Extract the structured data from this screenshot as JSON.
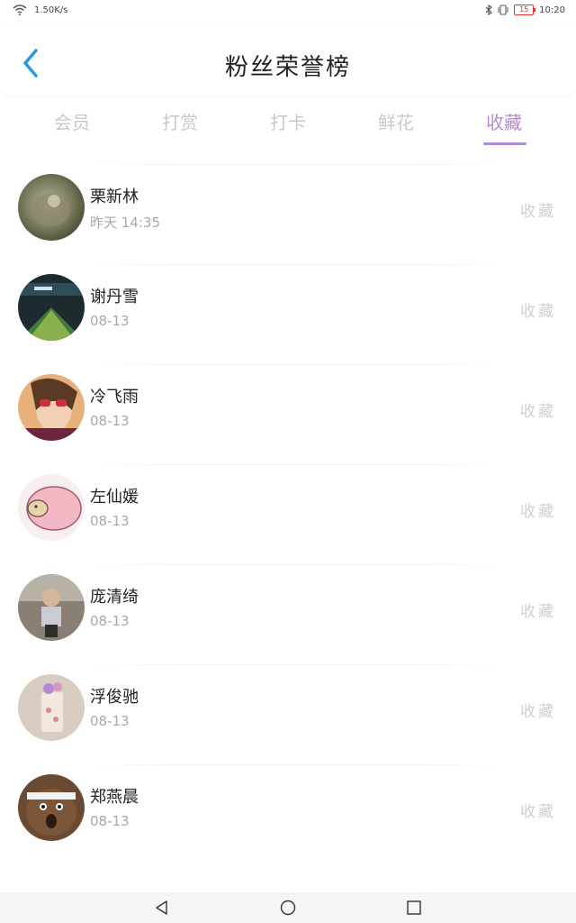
{
  "status_bar": {
    "net_speed": "1.50K/s",
    "battery": "15",
    "time": "10:20"
  },
  "header": {
    "title": "粉丝荣誉榜",
    "back_icon": "chevron-left-icon",
    "accent": "#2a9be0"
  },
  "tabs": [
    {
      "label": "会员",
      "active": false
    },
    {
      "label": "打赏",
      "active": false
    },
    {
      "label": "打卡",
      "active": false
    },
    {
      "label": "鲜花",
      "active": false
    },
    {
      "label": "收藏",
      "active": true
    }
  ],
  "active_color": "#b58bd6",
  "fans": [
    {
      "name": "栗新林",
      "time": "昨天 14:35",
      "action": "收藏"
    },
    {
      "name": "谢丹雪",
      "time": "08-13",
      "action": "收藏"
    },
    {
      "name": "冷飞雨",
      "time": "08-13",
      "action": "收藏"
    },
    {
      "name": "左仙媛",
      "time": "08-13",
      "action": "收藏"
    },
    {
      "name": "庞清绮",
      "time": "08-13",
      "action": "收藏"
    },
    {
      "name": "浮俊驰",
      "time": "08-13",
      "action": "收藏"
    },
    {
      "name": "郑燕晨",
      "time": "08-13",
      "action": "收藏"
    }
  ],
  "nav": {
    "back_icon": "triangle-back-icon",
    "home_icon": "circle-home-icon",
    "recents_icon": "square-recents-icon"
  }
}
